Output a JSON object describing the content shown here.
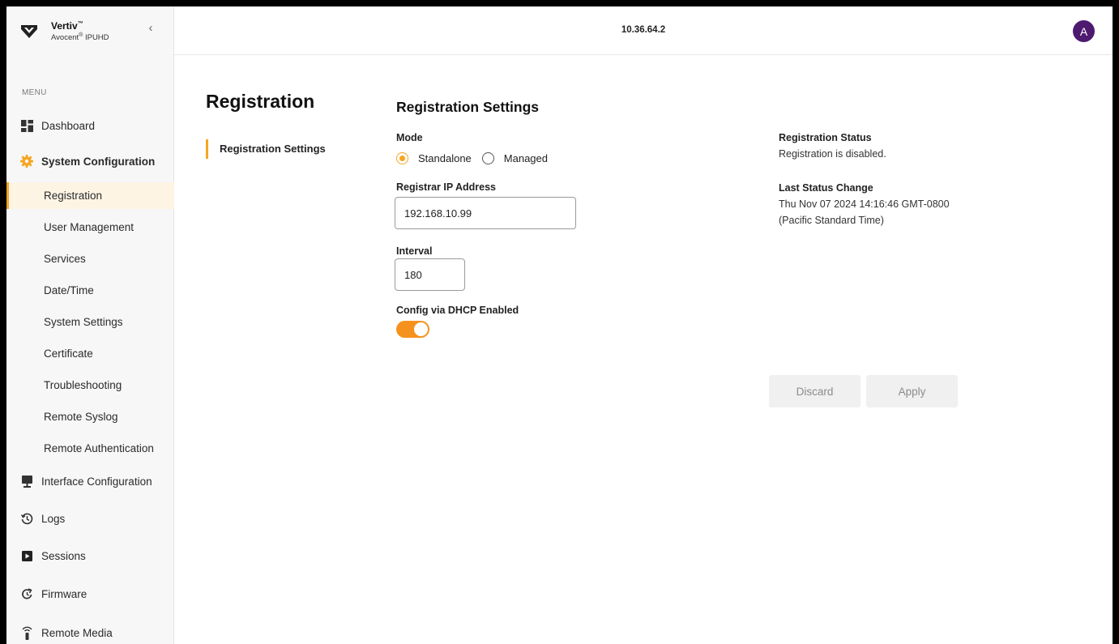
{
  "brand": {
    "name": "Vertiv",
    "name_mark": "™",
    "product_prefix": "Avocent",
    "product_mark": "®",
    "product_name": " IPUHD",
    "collapse_glyph": "‹"
  },
  "header": {
    "ip": "10.36.64.2",
    "avatar_initial": "A",
    "avatar_color": "#4e1a6f"
  },
  "sidebar": {
    "menu_label": "MENU",
    "items": [
      {
        "label": "Dashboard",
        "icon": "dashboard-icon"
      },
      {
        "label": "System Configuration",
        "icon": "gear-icon"
      },
      {
        "label": "Interface Configuration",
        "icon": "monitor-icon"
      },
      {
        "label": "Logs",
        "icon": "history-icon"
      },
      {
        "label": "Sessions",
        "icon": "play-icon"
      },
      {
        "label": "Firmware",
        "icon": "refresh-icon"
      },
      {
        "label": "Remote Media",
        "icon": "remote-icon"
      }
    ],
    "sub_items": [
      {
        "label": "Registration",
        "active": true
      },
      {
        "label": "User Management"
      },
      {
        "label": "Services"
      },
      {
        "label": "Date/Time"
      },
      {
        "label": "System Settings"
      },
      {
        "label": "Certificate"
      },
      {
        "label": "Troubleshooting"
      },
      {
        "label": "Remote Syslog"
      },
      {
        "label": "Remote Authentication"
      }
    ]
  },
  "page": {
    "title": "Registration",
    "subnav": "Registration Settings"
  },
  "form": {
    "section_title": "Registration Settings",
    "mode_label": "Mode",
    "mode_options": [
      "Standalone",
      "Managed"
    ],
    "mode_selected": "Standalone",
    "registrar_ip_label": "Registrar IP Address",
    "registrar_ip_value": "192.168.10.99",
    "interval_label": "Interval",
    "interval_value": "180",
    "dhcp_label": "Config via DHCP Enabled",
    "dhcp_enabled": true
  },
  "status": {
    "registration_status_label": "Registration Status",
    "registration_status_value": "Registration is disabled.",
    "last_change_label": "Last Status Change",
    "last_change_line1": "Thu Nov 07 2024 14:16:46 GMT-0800",
    "last_change_line2": "(Pacific Standard Time)"
  },
  "actions": {
    "discard": "Discard",
    "apply": "Apply"
  },
  "colors": {
    "accent": "#f5a623",
    "toggle": "#f5921e",
    "active_bg": "#fdf4e4"
  }
}
